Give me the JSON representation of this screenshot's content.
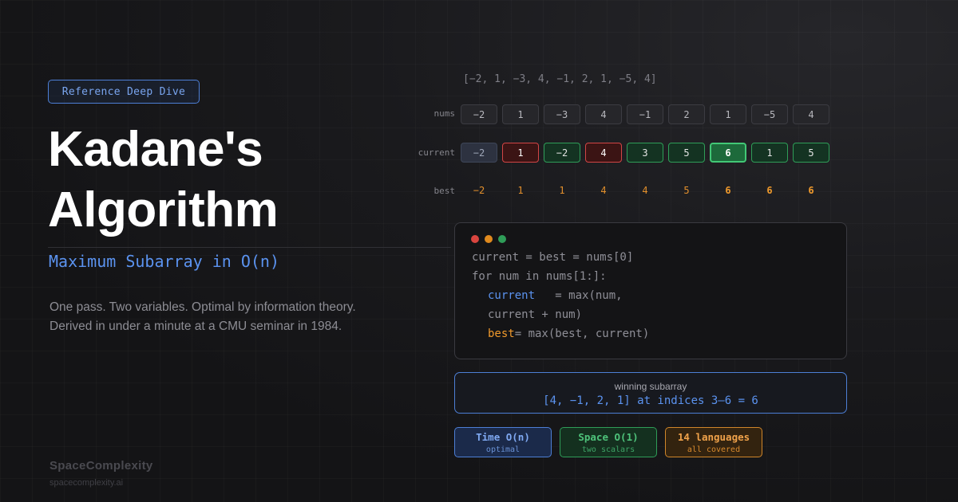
{
  "badge": "Reference Deep Dive",
  "title_line1": "Kadane's",
  "title_line2": "Algorithm",
  "subtitle": "Maximum Subarray in O(n)",
  "description_line1": "One pass. Two variables. Optimal by information theory.",
  "description_line2": "Derived in under a minute at a CMU seminar in 1984.",
  "brand": {
    "name": "SpaceComplexity",
    "url": "spacecomplexity.ai"
  },
  "array_literal": "[−2, 1, −3, 4, −1, 2, 1, −5, 4]",
  "rows": {
    "nums_label": "nums",
    "current_label": "current",
    "best_label": "best",
    "nums": [
      "−2",
      "1",
      "−3",
      "4",
      "−1",
      "2",
      "1",
      "−5",
      "4"
    ],
    "current": [
      "−2",
      "1",
      "−2",
      "4",
      "3",
      "5",
      "6",
      "1",
      "5"
    ],
    "current_states": [
      "first",
      "red",
      "green",
      "red",
      "green",
      "green",
      "bright",
      "green",
      "green"
    ],
    "best": [
      "−2",
      "1",
      "1",
      "4",
      "4",
      "5",
      "6",
      "6",
      "6"
    ]
  },
  "code": {
    "dot_colors": [
      "#d9453f",
      "#e08a1e",
      "#2f9d58"
    ],
    "line1": "current = best = nums[0]",
    "line2": "for num in nums[1:]:",
    "line3_kw": "current",
    "line3_rest": "   = max(num,",
    "line4": "current + num)",
    "line5_kw": "best",
    "line5_rest": "= max(best, current)"
  },
  "winning": {
    "label": "winning subarray",
    "value": "[4, −1, 2, 1] at indices 3–6 = 6"
  },
  "stats": [
    {
      "main": "Time O(n)",
      "sub": "optimal"
    },
    {
      "main": "Space O(1)",
      "sub": "two scalars"
    },
    {
      "main": "14 languages",
      "sub": "all covered"
    }
  ],
  "colors": {
    "accent_blue": "#5b93f0",
    "accent_green": "#2f9d58",
    "accent_red": "#d24545",
    "accent_orange": "#f09a2c"
  }
}
